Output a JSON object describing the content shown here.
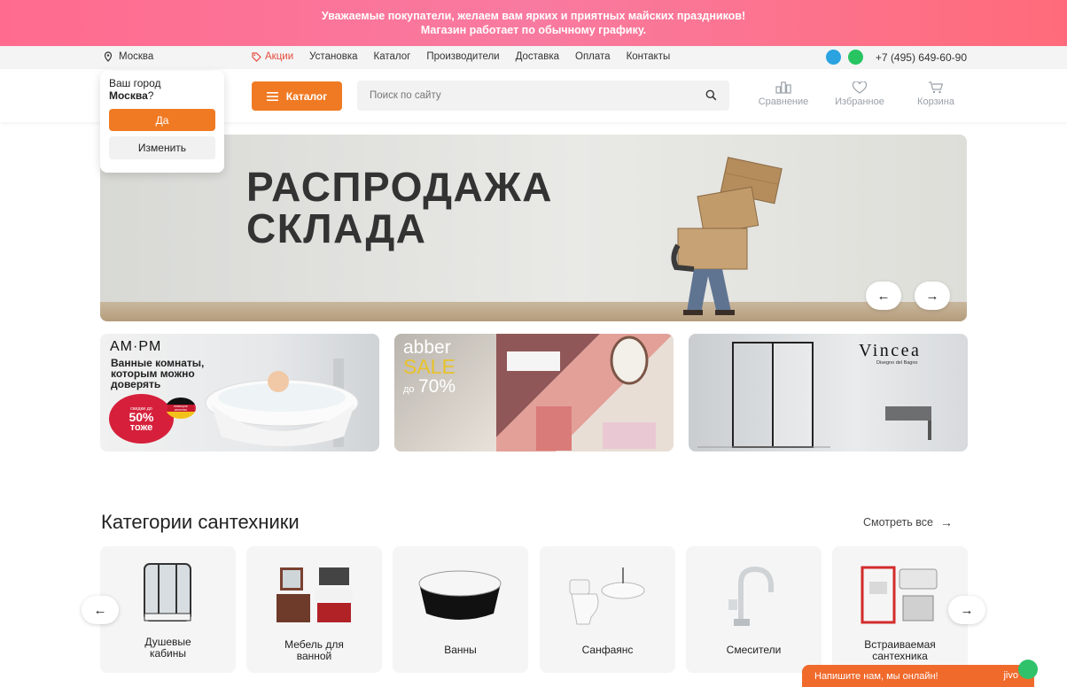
{
  "promo": {
    "line1": "Уважаемые покупатели, желаем вам ярких и приятных майских праздников!",
    "line2": "Магазин работает по обычному графику."
  },
  "topbar": {
    "city": "Москва",
    "nav": [
      "Акции",
      "Установка",
      "Каталог",
      "Производители",
      "Доставка",
      "Оплата",
      "Контакты"
    ],
    "phone": "+7 (495) 649-60-90"
  },
  "header": {
    "catalog_label": "Каталог",
    "search_placeholder": "Поиск по сайту",
    "compare_label": "Сравнение",
    "favorites_label": "Избранное",
    "cart_label": "Корзина"
  },
  "city_popup": {
    "question": "Ваш город",
    "city": "Москва",
    "qmark": "?",
    "yes_label": "Да",
    "change_label": "Изменить"
  },
  "hero": {
    "line1": "РАСПРОДАЖА",
    "line2": "СКЛАДА"
  },
  "banners": {
    "ampm": {
      "brand": "AM·PM",
      "text1": "Ванные комнаты,",
      "text2": "которым можно",
      "text3": "доверять",
      "badge_small": "скидки до",
      "badge_value": "50%",
      "badge_tail": "тоже",
      "quality": "немецкое качество"
    },
    "abber": {
      "brand": "abber",
      "sale": "SALE",
      "upto": "до",
      "value": "70%"
    },
    "vincea": {
      "brand": "Vincea",
      "tagline": "Disegno del Bagno"
    }
  },
  "categories": {
    "title": "Категории сантехники",
    "see_all": "Смотреть все",
    "items": [
      {
        "l1": "Душевые",
        "l2": "кабины"
      },
      {
        "l1": "Мебель для",
        "l2": "ванной"
      },
      {
        "l1": "Ванны",
        "l2": ""
      },
      {
        "l1": "Санфаянс",
        "l2": ""
      },
      {
        "l1": "Смесители",
        "l2": ""
      },
      {
        "l1": "Встраиваемая",
        "l2": "сантехника"
      }
    ]
  },
  "chat": {
    "label": "Напишите нам, мы онлайн!",
    "brand": "jivo"
  },
  "colors": {
    "accent": "#f07a23",
    "sale_red": "#e54b3c",
    "promo_pink": "#f97aa0"
  }
}
